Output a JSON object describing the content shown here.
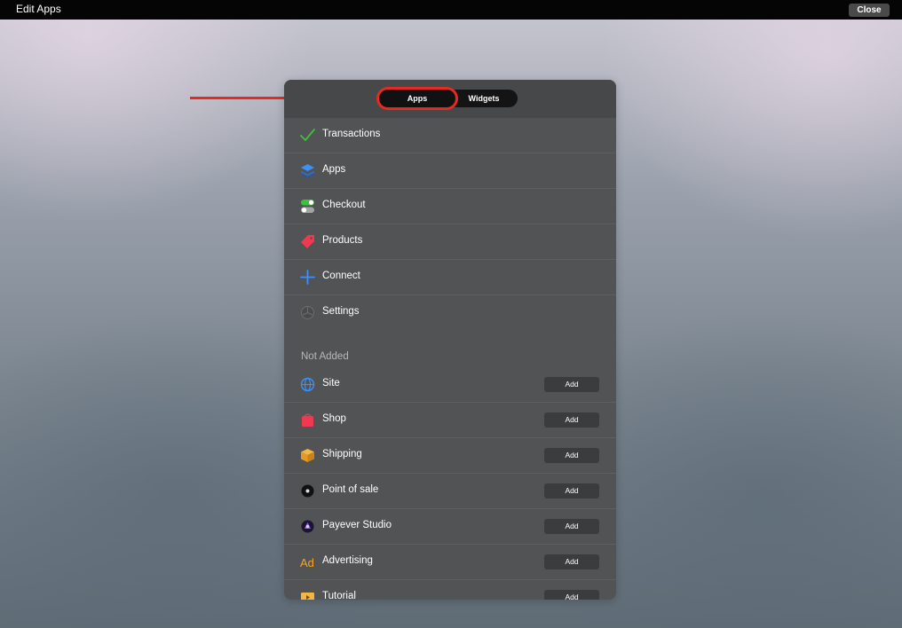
{
  "topbar": {
    "title": "Edit Apps",
    "close_label": "Close"
  },
  "panel": {
    "tabs": [
      {
        "label": "Apps",
        "active": true
      },
      {
        "label": "Widgets",
        "active": false
      }
    ],
    "added": [
      {
        "label": "Transactions",
        "icon": "checkmark-icon"
      },
      {
        "label": "Apps",
        "icon": "layers-icon"
      },
      {
        "label": "Checkout",
        "icon": "toggles-icon"
      },
      {
        "label": "Products",
        "icon": "price-tag-icon"
      },
      {
        "label": "Connect",
        "icon": "plus-icon"
      },
      {
        "label": "Settings",
        "icon": "gear-icon"
      }
    ],
    "not_added_title": "Not Added",
    "not_added": [
      {
        "label": "Site",
        "icon": "globe-icon",
        "action": "Add"
      },
      {
        "label": "Shop",
        "icon": "shopping-bag-icon",
        "action": "Add"
      },
      {
        "label": "Shipping",
        "icon": "box-icon",
        "action": "Add"
      },
      {
        "label": "Point of sale",
        "icon": "pos-dot-icon",
        "action": "Add"
      },
      {
        "label": "Payever Studio",
        "icon": "studio-icon",
        "action": "Add"
      },
      {
        "label": "Advertising",
        "icon": "ad-icon",
        "action": "Add"
      },
      {
        "label": "Tutorial",
        "icon": "video-icon",
        "action": "Add"
      }
    ]
  },
  "colors": {
    "accent_red": "#e52b21",
    "panel_bg": "#525354",
    "topbar_bg": "#050505"
  }
}
